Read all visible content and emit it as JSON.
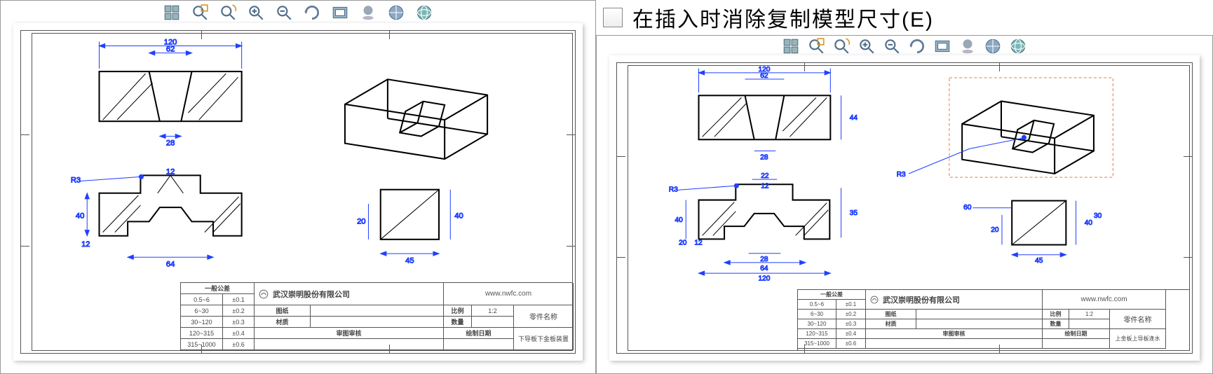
{
  "checkbox": {
    "label": "在插入时消除复制模型尺寸(E)",
    "checked": false
  },
  "toolbar": {
    "icons": [
      "arrange-icon",
      "zoom-area-icon",
      "zoom-rotate-icon",
      "zoom-in-icon",
      "zoom-out-icon",
      "rotate-icon",
      "extents-icon",
      "shadow-icon",
      "display-icon",
      "globe-icon"
    ]
  },
  "title_block": {
    "company": "武汉崇明股份有限公司",
    "url": "www.nwfc.com",
    "tolerance_header": "一般公差",
    "rows": [
      {
        "range": "0.5~6",
        "tol": "±0.1"
      },
      {
        "range": "6~30",
        "tol": "±0.2"
      },
      {
        "range": "30~120",
        "tol": "±0.3"
      },
      {
        "range": "120~315",
        "tol": "±0.4"
      },
      {
        "range": "315~1000",
        "tol": "±0.6"
      }
    ],
    "fields": {
      "drawn_label": "图纸",
      "drawn_val": "",
      "material_label": "材质",
      "material_val": "",
      "review_label": "审图审核",
      "ratio_label": "比例",
      "ratio_val": "1:2",
      "qty_label": "数量",
      "qty_val": "",
      "date_label": "绘制日期",
      "part_name_label": "零件名称",
      "left_footer": "下导板下金板装置",
      "right_footer": "上金板上导板逢水"
    }
  },
  "dimensions_left": {
    "top_width": "120",
    "top_inner": "62",
    "top_drop": "28",
    "front_height": "40",
    "front_step": "12",
    "front_width": "64",
    "front_slot": "12",
    "front_r": "R3",
    "side_w": "45",
    "side_h": "40",
    "side_step": "20"
  },
  "dimensions_right": {
    "top_width": "120",
    "top_inner": "62",
    "top_height": "44",
    "top_drop": "28",
    "front_height": "40",
    "front_inner_h": "35",
    "front_step": "20",
    "front_step2": "12",
    "front_slot_w": "22",
    "front_slot_d": "12",
    "front_under_w": "28",
    "front_width": "64",
    "front_full": "120",
    "front_r1": "R3",
    "iso_r": "R3",
    "leader_len": "60",
    "side_w": "45",
    "side_h": "40",
    "side_inner": "30",
    "side_step": "20"
  }
}
